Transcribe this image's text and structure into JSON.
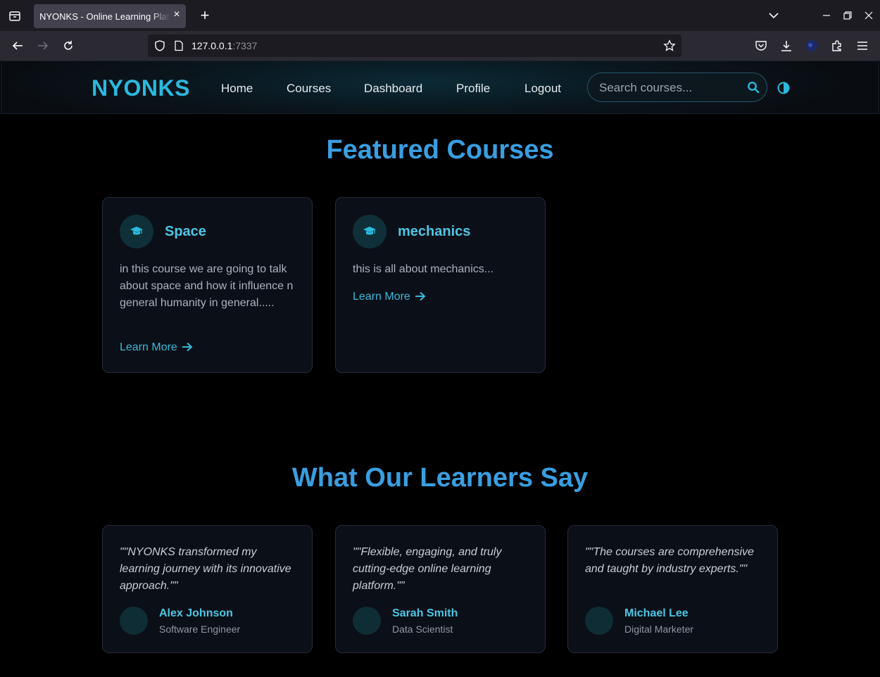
{
  "browser": {
    "tab_title": "NYONKS - Online Learning Platform",
    "url_host": "127.0.0.1",
    "url_port": ":7337"
  },
  "header": {
    "brand": "NYONKS",
    "nav": [
      "Home",
      "Courses",
      "Dashboard",
      "Profile",
      "Logout"
    ],
    "search_placeholder": "Search courses..."
  },
  "featured": {
    "title": "Featured Courses",
    "courses": [
      {
        "name": "Space",
        "description": "in this course we are going to talk about space and how it influence n general humanity in general.....",
        "link": "Learn More"
      },
      {
        "name": "mechanics",
        "description": "this is all about mechanics...",
        "link": "Learn More"
      }
    ]
  },
  "testimonials": {
    "title": "What Our Learners Say",
    "items": [
      {
        "quote": "\"\"NYONKS transformed my learning journey with its innovative approach.\"\"",
        "name": "Alex Johnson",
        "role": "Software Engineer"
      },
      {
        "quote": "\"\"Flexible, engaging, and truly cutting-edge online learning platform.\"\"",
        "name": "Sarah Smith",
        "role": "Data Scientist"
      },
      {
        "quote": "\"\"The courses are comprehensive and taught by industry experts.\"\"",
        "name": "Michael Lee",
        "role": "Digital Marketer"
      }
    ]
  },
  "colors": {
    "accent": "#2bb9de",
    "heading": "#3a9ee0",
    "card_bg": "#0b0f17",
    "page_bg": "#000000"
  }
}
